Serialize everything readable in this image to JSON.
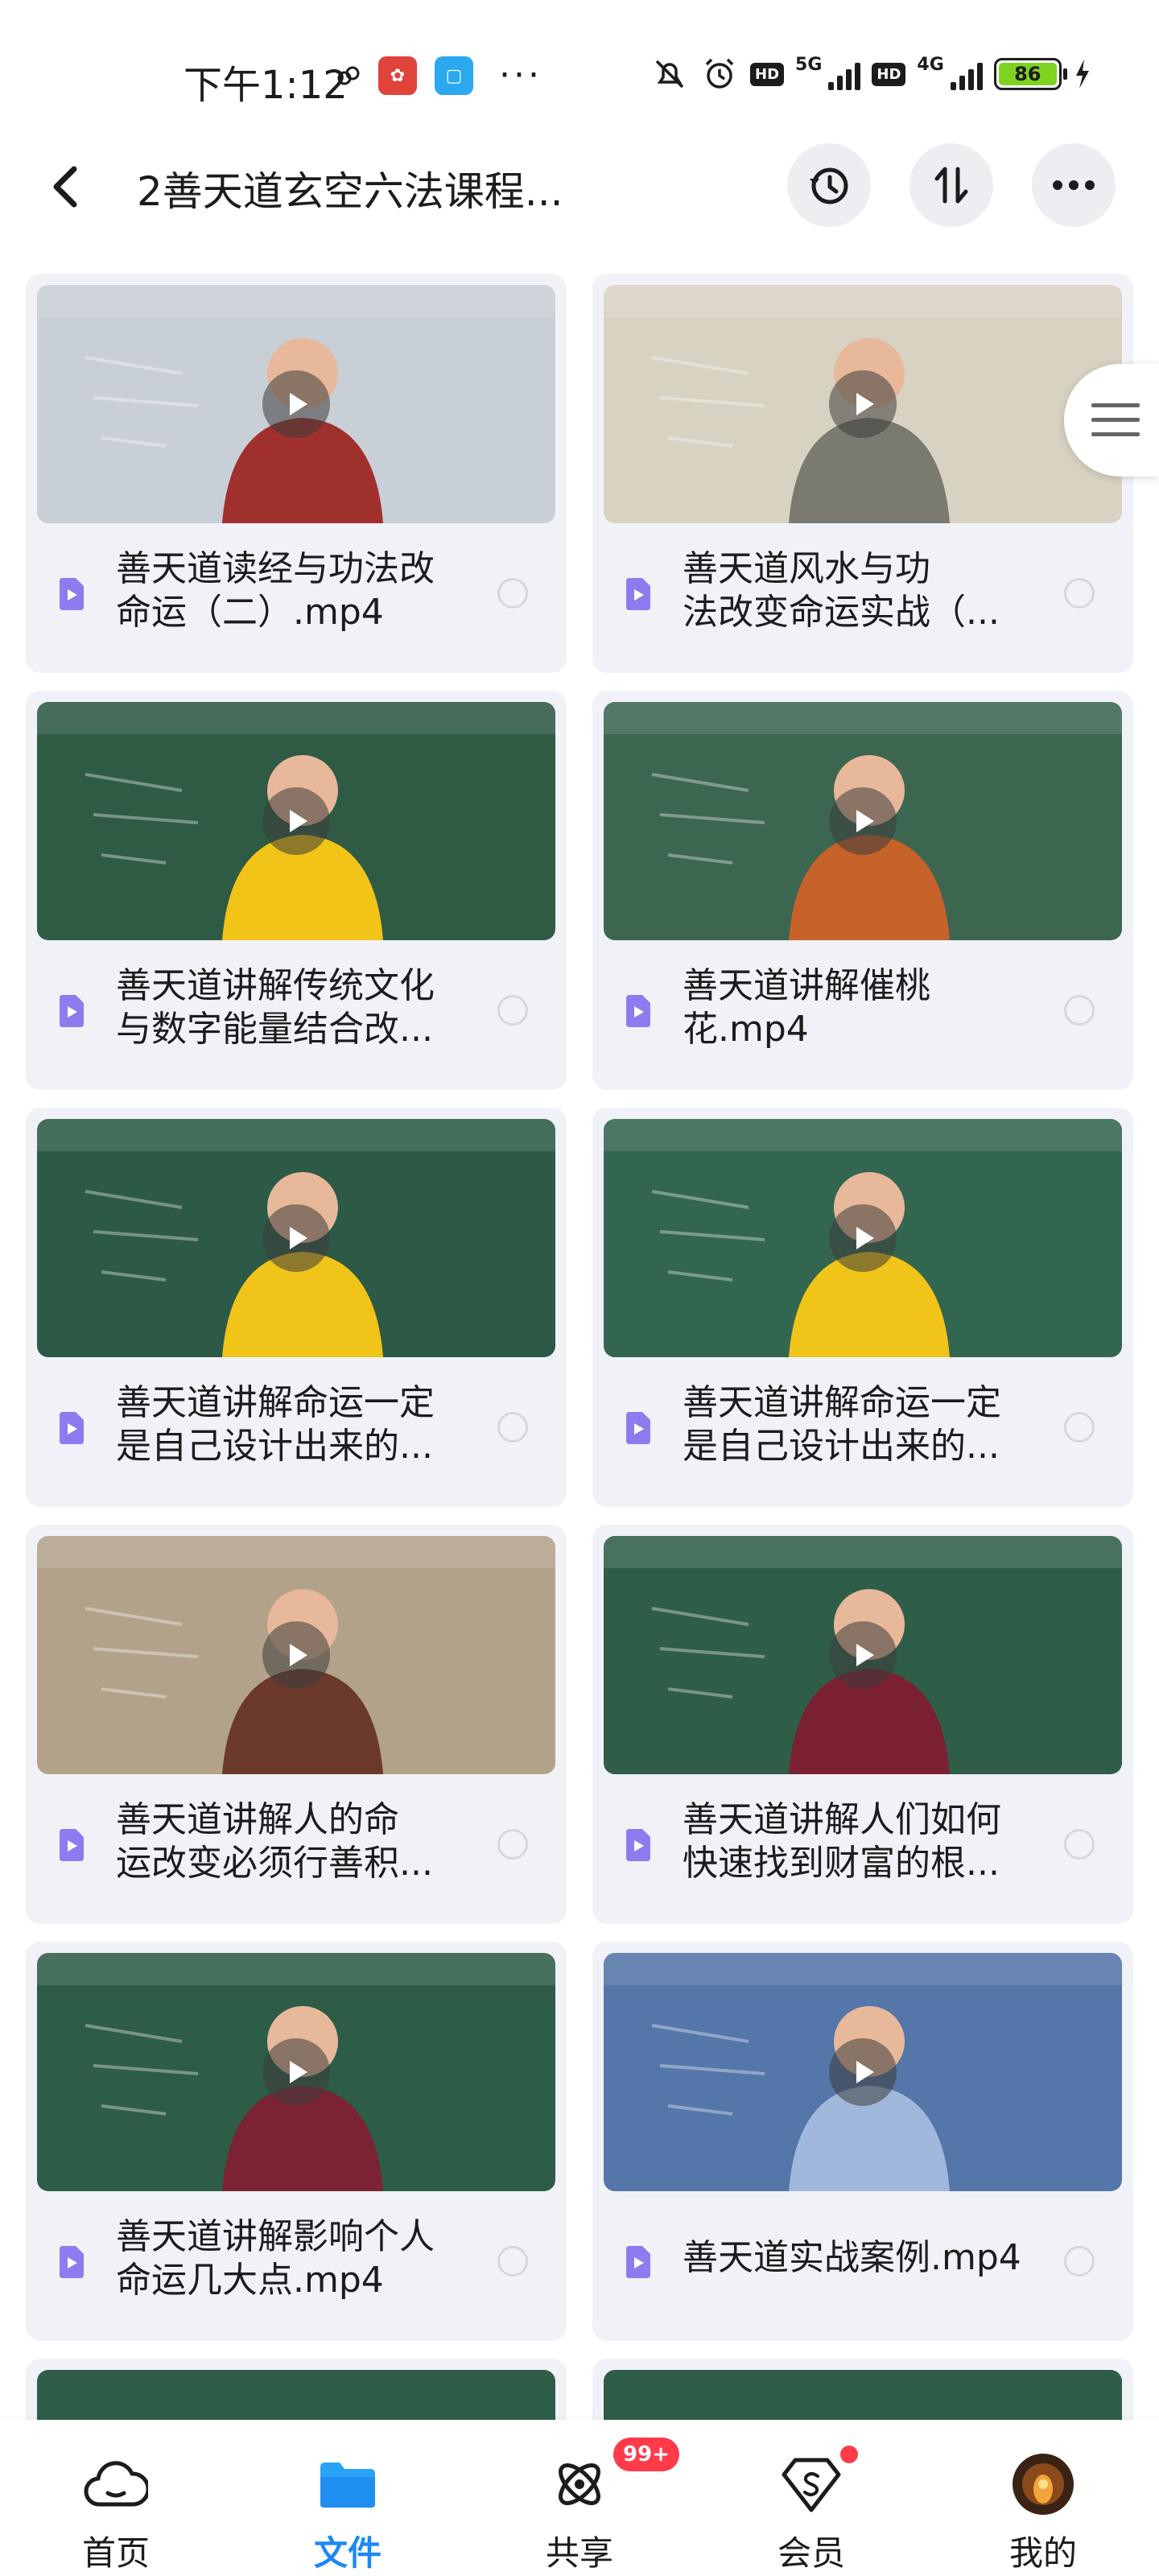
{
  "status_bar": {
    "time": "下午1:12",
    "network_5g": "5G",
    "network_4g": "4G",
    "hd": "HD",
    "battery": "86"
  },
  "header": {
    "title": "2善天道玄空六法课程..."
  },
  "files": [
    {
      "title": "善天道读经与功法改命运（二）.mp4",
      "line1": "善天道读经与功法改",
      "line2": "命运（二）.mp4",
      "bg": "#c9cfd6",
      "accent": "#a0302c"
    },
    {
      "title": "善天道风水与功法改变命运实战（...",
      "line1": "善天道风水与功",
      "line2": "法改变命运实战（...",
      "bg": "#d8d2c2",
      "accent": "#7a7a70"
    },
    {
      "title": "善天道讲解传统文化与数字能量结合改...",
      "line1": "善天道讲解传统文化",
      "line2": "与数字能量结合改...",
      "bg": "#2f5b45",
      "accent": "#f2c418"
    },
    {
      "title": "善天道讲解催桃花.mp4",
      "line1": "善天道讲解催桃",
      "line2": "花.mp4",
      "bg": "#3d6651",
      "accent": "#c7622a"
    },
    {
      "title": "善天道讲解命运一定是自己设计出来的...",
      "line1": "善天道讲解命运一定",
      "line2": "是自己设计出来的...",
      "bg": "#2d5a46",
      "accent": "#f0c419"
    },
    {
      "title": "善天道讲解命运一定是自己设计出来的...",
      "line1": "善天道讲解命运一定",
      "line2": "是自己设计出来的...",
      "bg": "#336650",
      "accent": "#f0c419"
    },
    {
      "title": "善天道讲解人的命运改变必须行善积...",
      "line1": "善天道讲解人的命",
      "line2": "运改变必须行善积...",
      "bg": "#b3a28a",
      "accent": "#6b3a2a"
    },
    {
      "title": "善天道讲解人们如何快速找到财富的根...",
      "line1": "善天道讲解人们如何",
      "line2": "快速找到财富的根...",
      "bg": "#2f5e48",
      "accent": "#7b2030"
    },
    {
      "title": "善天道讲解影响个人命运几大点.mp4",
      "line1": "善天道讲解影响个人",
      "line2": "命运几大点.mp4",
      "bg": "#2e5d47",
      "accent": "#7b2233"
    },
    {
      "title": "善天道实战案例.mp4",
      "line1": "善天道实战案例.mp4",
      "line2": "",
      "bg": "#5576a8",
      "accent": "#9fb8dc"
    }
  ],
  "bottom_nav": {
    "home": "首页",
    "files": "文件",
    "share": "共享",
    "vip": "会员",
    "me": "我的",
    "share_badge": "99+"
  },
  "colors": {
    "accent": "#1e88f5",
    "card_bg": "#f1f2f7",
    "badge": "#ff3b4a",
    "file_icon": "#8c7cf0"
  }
}
